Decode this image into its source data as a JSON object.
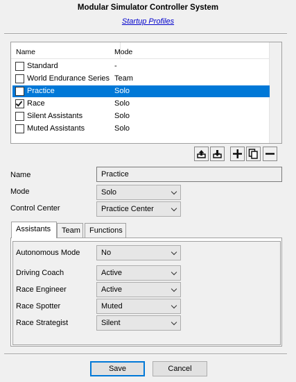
{
  "header": {
    "title": "Modular Simulator Controller System",
    "link": "Startup Profiles"
  },
  "list": {
    "columns": {
      "name": "Name",
      "mode": "Mode"
    },
    "rows": [
      {
        "name": "Standard",
        "mode": "-",
        "checked": false,
        "selected": false
      },
      {
        "name": "World Endurance Series",
        "mode": "Team",
        "checked": false,
        "selected": false
      },
      {
        "name": "Practice",
        "mode": "Solo",
        "checked": false,
        "selected": true
      },
      {
        "name": "Race",
        "mode": "Solo",
        "checked": true,
        "selected": false
      },
      {
        "name": "Silent Assistants",
        "mode": "Solo",
        "checked": false,
        "selected": false
      },
      {
        "name": "Muted Assistants",
        "mode": "Solo",
        "checked": false,
        "selected": false
      }
    ]
  },
  "toolbar": {
    "icons": [
      "upload-icon",
      "download-icon",
      "plus-icon",
      "copy-icon",
      "minus-icon"
    ]
  },
  "form": {
    "name_label": "Name",
    "name_value": "Practice",
    "mode_label": "Mode",
    "mode_value": "Solo",
    "control_label": "Control Center",
    "control_value": "Practice Center"
  },
  "tabs": [
    "Assistants",
    "Team",
    "Functions"
  ],
  "assistants": {
    "autonomous_label": "Autonomous Mode",
    "autonomous_value": "No",
    "coach_label": "Driving Coach",
    "coach_value": "Active",
    "engineer_label": "Race Engineer",
    "engineer_value": "Active",
    "spotter_label": "Race Spotter",
    "spotter_value": "Muted",
    "strategist_label": "Race Strategist",
    "strategist_value": "Silent"
  },
  "buttons": {
    "save": "Save",
    "cancel": "Cancel"
  },
  "colors": {
    "selection": "#0078d7",
    "link": "#0000cc"
  }
}
